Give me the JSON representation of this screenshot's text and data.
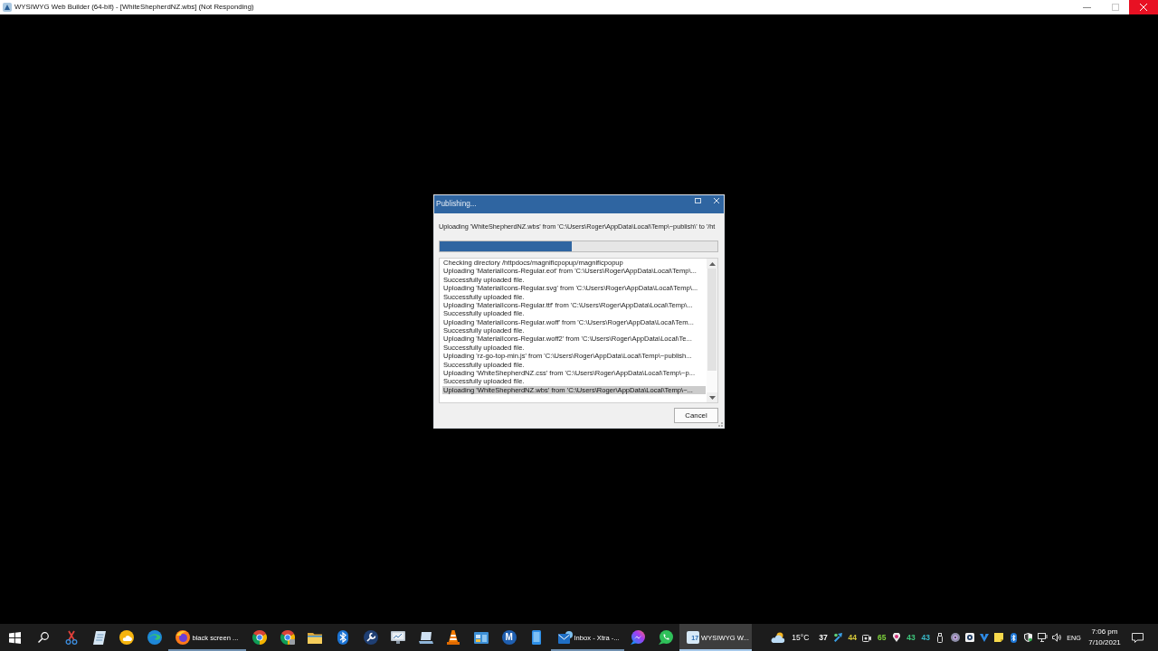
{
  "window": {
    "title": "WYSIWYG Web Builder (64-bit) - [WhiteShepherdNZ.wbs] (Not Responding)"
  },
  "dialog": {
    "title": "Publishing...",
    "status": "Uploading 'WhiteShepherdNZ.wbs' from 'C:\\Users\\Roger\\AppData\\Local\\Temp\\~publish\\' to '/ht",
    "progress": {
      "level": 0.475
    },
    "log": [
      {
        "text": "Checking directory /httpdocs/magnificpopup/magnificpopup",
        "selected": false
      },
      {
        "text": "Uploading 'MaterialIcons-Regular.eot' from 'C:\\Users\\Roger\\AppData\\Local\\Temp\\...",
        "selected": false
      },
      {
        "text": "Successfully uploaded file.",
        "selected": false
      },
      {
        "text": "Uploading 'MaterialIcons-Regular.svg' from 'C:\\Users\\Roger\\AppData\\Local\\Temp\\...",
        "selected": false
      },
      {
        "text": "Successfully uploaded file.",
        "selected": false
      },
      {
        "text": "Uploading 'MaterialIcons-Regular.ttf' from 'C:\\Users\\Roger\\AppData\\Local\\Temp\\...",
        "selected": false
      },
      {
        "text": "Successfully uploaded file.",
        "selected": false
      },
      {
        "text": "Uploading 'MaterialIcons-Regular.woff' from 'C:\\Users\\Roger\\AppData\\Local\\Tem...",
        "selected": false
      },
      {
        "text": "Successfully uploaded file.",
        "selected": false
      },
      {
        "text": "Uploading 'MaterialIcons-Regular.woff2' from 'C:\\Users\\Roger\\AppData\\Local\\Te...",
        "selected": false
      },
      {
        "text": "Successfully uploaded file.",
        "selected": false
      },
      {
        "text": "Uploading 'rz-go-top-min.js' from 'C:\\Users\\Roger\\AppData\\Local\\Temp\\~publish...",
        "selected": false
      },
      {
        "text": "Successfully uploaded file.",
        "selected": false
      },
      {
        "text": "Uploading 'WhiteShepherdNZ.css' from 'C:\\Users\\Roger\\AppData\\Local\\Temp\\~p...",
        "selected": false
      },
      {
        "text": "Successfully uploaded file.",
        "selected": false
      },
      {
        "text": "Uploading 'WhiteShepherdNZ.wbs' from 'C:\\Users\\Roger\\AppData\\Local\\Temp\\~...",
        "selected": true
      }
    ],
    "buttons": [
      {
        "label": "Cancel"
      }
    ]
  },
  "taskbar": {
    "pinned_logo": {
      "text": "M"
    },
    "windows": [
      {
        "label": "black screen ...",
        "selected": false
      },
      {
        "label": "Inbox - Xtra -...",
        "selected": false
      },
      {
        "label": "WYSIWYG W...",
        "selected": true,
        "logo_text": "17"
      }
    ],
    "weather": {
      "temperature": "15°C"
    },
    "tray_readings": [
      {
        "text": "37",
        "color": "#ffffff"
      },
      {
        "text": "44",
        "color": "#d6c83a"
      },
      {
        "text": "65",
        "color": "#7ed43c"
      },
      {
        "text": "43",
        "color": "#3ec77c"
      },
      {
        "text": "43",
        "color": "#39b9c8"
      }
    ],
    "language": "ENG",
    "clock": {
      "time": "7:06 pm",
      "date": "7/10/2021"
    }
  }
}
